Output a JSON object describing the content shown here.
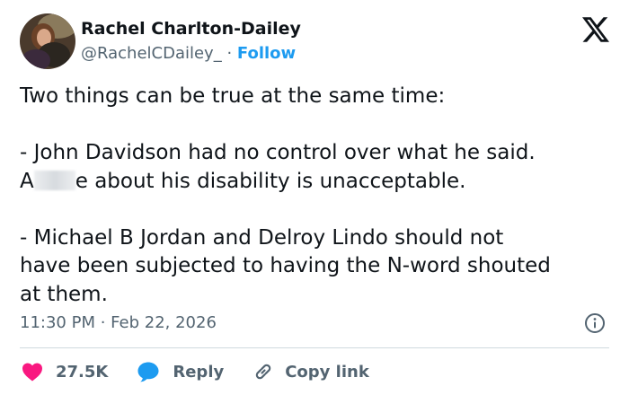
{
  "author": {
    "name": "Rachel Charlton-Dailey",
    "handle": "@RachelCDailey_",
    "separator": " · ",
    "follow_label": "Follow"
  },
  "tweet": {
    "line1": "Two things can be true at the same time:",
    "line2": "- John Davidson had no control over what he said.",
    "line3_start": "A",
    "line3_end": "e about his disability is unacceptable.",
    "line4": "- Michael B Jordan and Delroy Lindo should not",
    "line5": "have been subjected to having the N-word shouted",
    "line6": "at them."
  },
  "meta": {
    "timestamp": "11:30 PM · Feb 22, 2026"
  },
  "actions": {
    "like_count": "27.5K",
    "reply_label": "Reply",
    "copy_link_label": "Copy link"
  },
  "colors": {
    "like": "#f91880",
    "reply": "#1d9bf0",
    "link": "#1d9bf0",
    "muted": "#536471",
    "text": "#0f1419"
  },
  "icons": [
    "x-logo-icon",
    "info-icon",
    "heart-icon",
    "reply-bubble-icon",
    "link-icon"
  ]
}
